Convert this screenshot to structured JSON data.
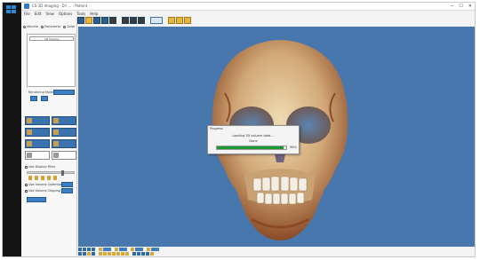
{
  "window": {
    "title": "CS 3D Imaging · D:\\ ... · Patient",
    "controls": [
      "─",
      "☐",
      "✕"
    ]
  },
  "menu": [
    "File",
    "Edit",
    "View",
    "Options",
    "Tools",
    "Help"
  ],
  "view_tabs": [
    "Volume",
    "Panoramic",
    "Axial"
  ],
  "left_panel": {
    "selected_item": "3D Volume",
    "options_label": "Rendering Mode",
    "overlay_checkbox": "Use Display Filter",
    "check_a": "Use Volume Optimization",
    "check_b": "Use Volume Clipping"
  },
  "progress_dialog": {
    "title": "Progress",
    "message": "Loading 3D volume data....",
    "status": "Done",
    "percent_text": "96%",
    "percent": 96
  },
  "colors": {
    "viewer_background": "#4777ad",
    "taskbar": "#141414",
    "progress_fill": "#1a9a2e",
    "tool_button": "#3a73ad"
  },
  "icons": {
    "tool_buttons": [
      "orbit-icon",
      "pan-icon",
      "zoom-icon",
      "measure-icon",
      "rotate-icon",
      "crop-icon",
      "annotate-icon",
      "reset-icon",
      "slice-icon",
      "export-icon"
    ],
    "toolbar": [
      "view-front-icon",
      "view-side-icon",
      "view-top-icon",
      "layout-icon",
      "print-icon",
      "email-icon",
      "settings-icon"
    ]
  }
}
